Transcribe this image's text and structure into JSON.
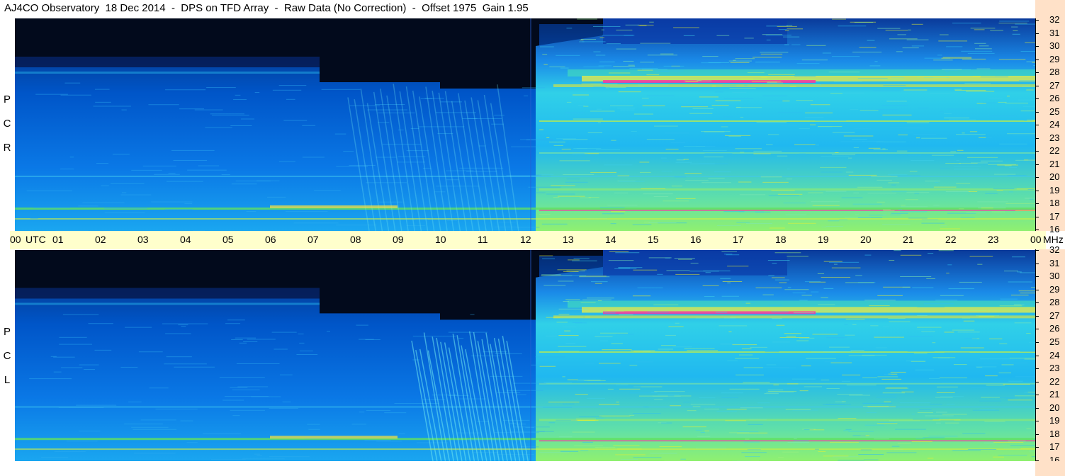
{
  "title": "AJ4CO Observatory  18 Dec 2014  -  DPS on TFD Array  -  Raw Data (No Correction)  -  Offset 1975  Gain 1.95",
  "panels": {
    "rcp": {
      "letters": [
        "P",
        "C",
        "R"
      ]
    },
    "lcp": {
      "letters": [
        "P",
        "C",
        "L"
      ]
    }
  },
  "time_axis": {
    "utc_label": "UTC",
    "unit_label": "MHz",
    "hours": [
      "00",
      "01",
      "02",
      "03",
      "04",
      "05",
      "06",
      "07",
      "08",
      "09",
      "10",
      "11",
      "12",
      "13",
      "14",
      "15",
      "16",
      "17",
      "18",
      "19",
      "20",
      "21",
      "22",
      "23",
      "00"
    ]
  },
  "freq_axis": {
    "labels": [
      "32",
      "31",
      "30",
      "29",
      "28",
      "27",
      "26",
      "25",
      "24",
      "23",
      "22",
      "21",
      "20",
      "19",
      "18",
      "17",
      "16"
    ]
  },
  "colors": {
    "background_dark": "#000814",
    "deep_blue": "#0a2a6e",
    "mid_blue": "#0066dd",
    "cyan": "#20c8f0",
    "green": "#80f080",
    "yellow": "#e8f030",
    "magenta": "#ff30a0",
    "time_axis_bg": "#ffffcc",
    "freq_axis_bg": "#ffe1c8"
  }
}
